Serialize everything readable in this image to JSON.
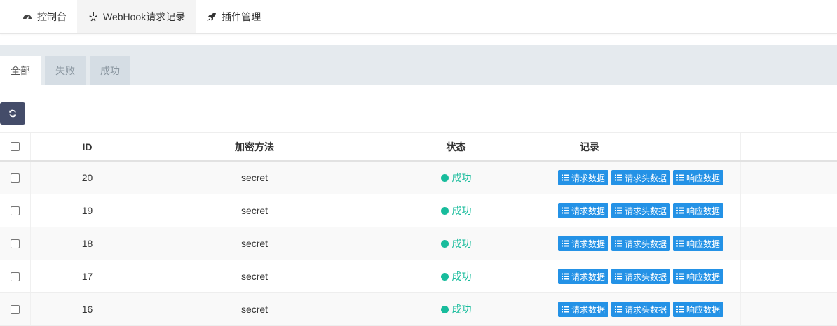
{
  "nav": {
    "tabs": [
      {
        "label": "控制台",
        "icon": "dashboard-icon"
      },
      {
        "label": "WebHook请求记录",
        "icon": "yelp-icon"
      },
      {
        "label": "插件管理",
        "icon": "rocket-icon"
      }
    ],
    "active_index": 1
  },
  "subtabs": [
    {
      "label": "全部"
    },
    {
      "label": "失败"
    },
    {
      "label": "成功"
    }
  ],
  "subtab_active_index": 0,
  "toolbar": {
    "refresh_icon": "refresh-icon",
    "refresh_color": "#444c69"
  },
  "table": {
    "headers": {
      "id": "ID",
      "method": "加密方法",
      "status": "状态",
      "record": "记录"
    },
    "action_labels": {
      "request_data": "请求数据",
      "request_headers": "请求头数据",
      "response_data": "响应数据"
    },
    "rows": [
      {
        "id": "20",
        "method": "secret",
        "status": "成功"
      },
      {
        "id": "19",
        "method": "secret",
        "status": "成功"
      },
      {
        "id": "18",
        "method": "secret",
        "status": "成功"
      },
      {
        "id": "17",
        "method": "secret",
        "status": "成功"
      },
      {
        "id": "16",
        "method": "secret",
        "status": "成功"
      }
    ]
  },
  "colors": {
    "success": "#18bc9c",
    "action_button": "#2492e6",
    "subtab_bar": "#e5eaee"
  }
}
